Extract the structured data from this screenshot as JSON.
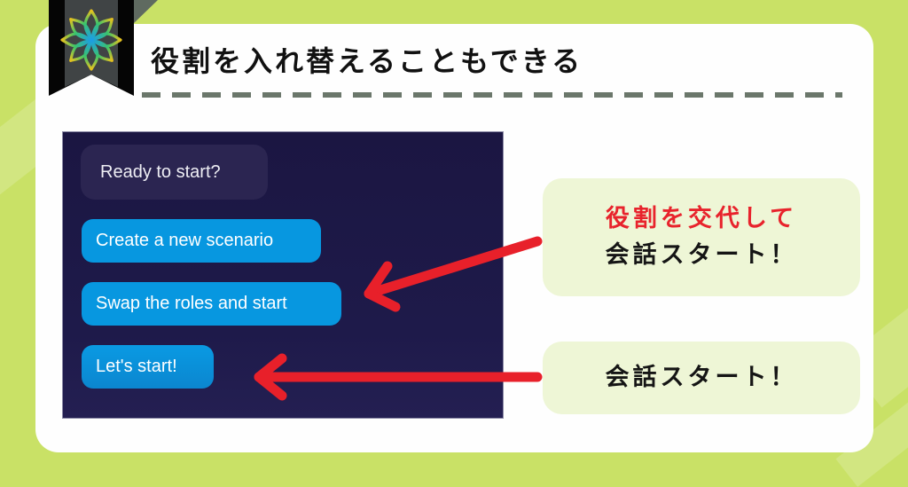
{
  "page": {
    "title": "役割を入れ替えることもできる",
    "colors": {
      "background": "#c9e166",
      "card": "#fefefe",
      "accent_red": "#e8232c",
      "button_blue": "#0797e0",
      "panel_dark": "#1b1642",
      "callout_bg": "#eef6d6",
      "dash": "#6b776b"
    },
    "logo_icon": "star-knot-logo-icon"
  },
  "app_screenshot": {
    "prompt_bubble": "Ready to start?",
    "options": [
      {
        "label": "Create a new scenario"
      },
      {
        "label": "Swap the roles and start"
      },
      {
        "label": "Let's start!"
      }
    ]
  },
  "callouts": [
    {
      "highlight": "役割を交代して",
      "text": "会話スタート！",
      "points_to": "Swap the roles and start"
    },
    {
      "highlight": "",
      "text": "会話スタート！",
      "points_to": "Let's start!"
    }
  ]
}
